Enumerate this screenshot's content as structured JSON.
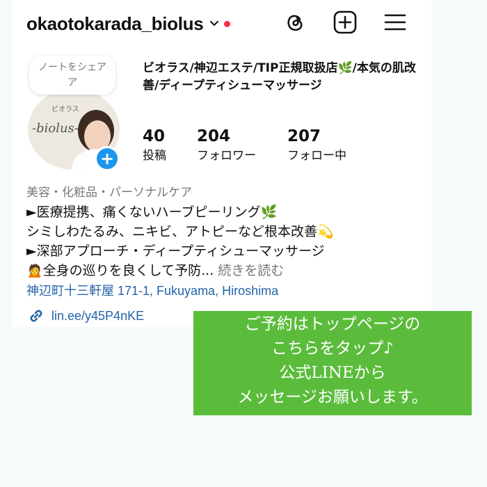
{
  "profile": {
    "handle": "okaotokarada_biolus",
    "note": "ノートをシェア",
    "avatar_text": [
      "ビオラス",
      "-biolus-"
    ],
    "bio_title": "ビオラス/神辺エステ/TIP正規取扱店🌿/本気の肌改善/ディープティシューマッサージ"
  },
  "stats": [
    {
      "value": "40",
      "label": "投稿"
    },
    {
      "value": "204",
      "label": "フォロワー"
    },
    {
      "value": "207",
      "label": "フォロー中"
    }
  ],
  "bio": {
    "category": "美容・化粧品・パーソナルケア",
    "line1": "►医療提携、痛くないハーブピーリング🌿",
    "line2": "シミしわたるみ、ニキビ、アトピーなど根本改善💫",
    "line3": "►深部アプローチ・ディープティシューマッサージ",
    "line4": "🙍全身の巡りを良くして予防...",
    "more": "続きを読む",
    "address": "神辺町十三軒屋 171-1, Fukuyama, Hiroshima",
    "link": "lin.ee/y45P4nKE"
  },
  "promo": {
    "line1": "ご予約はトップページの",
    "line2": "こちらをタップ♪",
    "line3": "公式LINEから",
    "line4": "メッセージお願いします。"
  },
  "icons": [
    "chevron-down-icon",
    "threads-icon",
    "new-post-icon",
    "menu-icon",
    "add-icon",
    "link-icon",
    "leaf-icon",
    "sparkle-icon"
  ],
  "colors": {
    "accent_blue": "#1e96f0",
    "link": "#2463a8",
    "promo_green": "#5bbc3c",
    "notify_red": "#ff2d41"
  }
}
